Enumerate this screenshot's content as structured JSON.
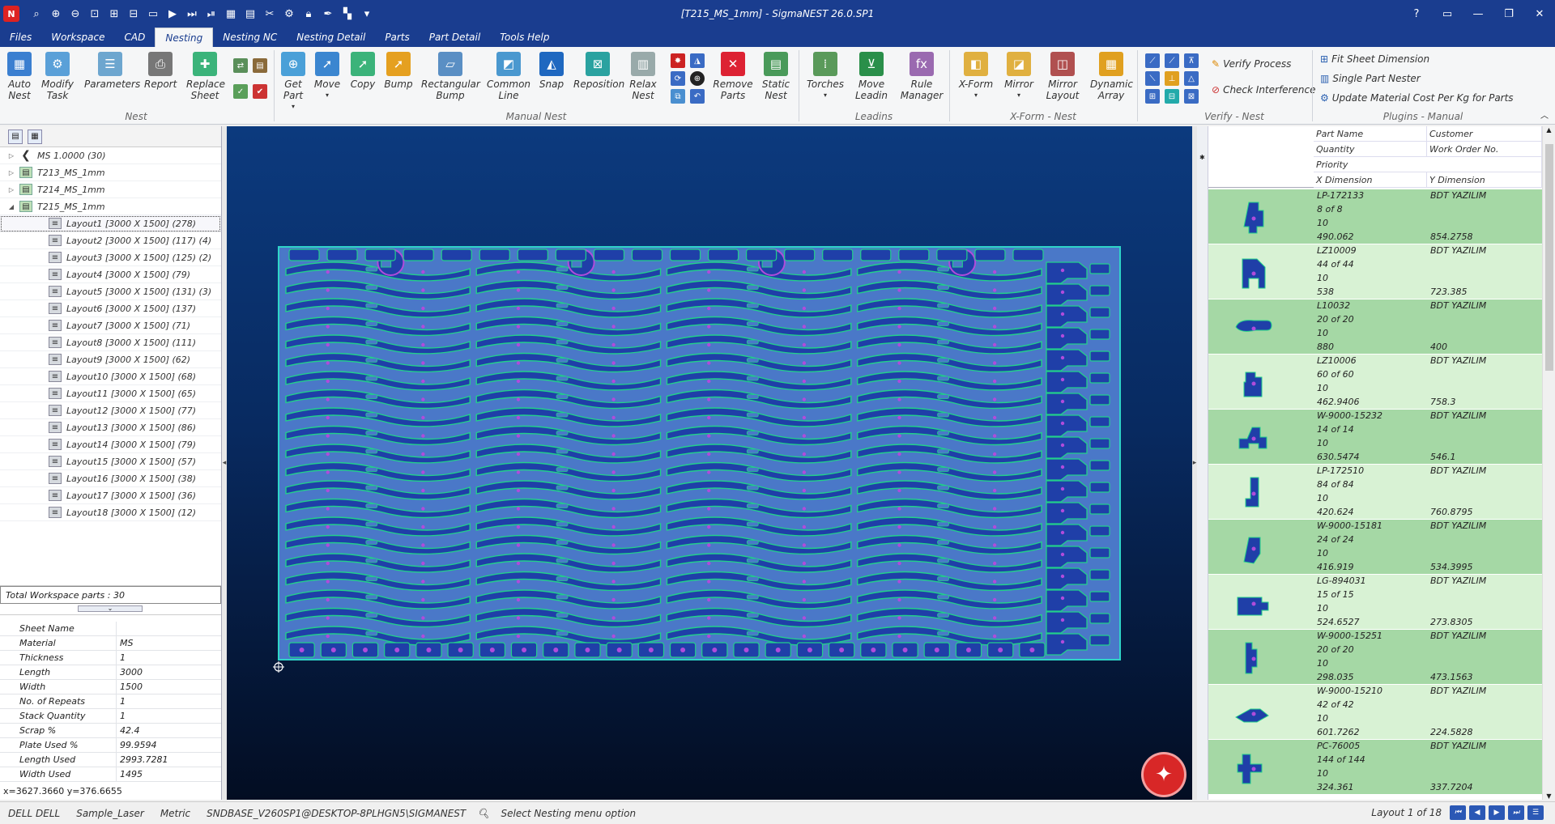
{
  "window": {
    "title": "[T215_MS_1mm] - SigmaNEST 26.0.SP1",
    "help": "?",
    "controls": [
      "minimize",
      "restore",
      "close"
    ]
  },
  "quick_access": {
    "icons": [
      "app-logo-icon",
      "zoom-menu-icon",
      "zoom-in-icon",
      "zoom-out-icon",
      "zoom-window-icon",
      "zoom-extents-icon",
      "zoom-previous-icon",
      "measure-icon",
      "play-icon",
      "play-all-icon",
      "step-icon",
      "tile-icon",
      "grid-icon",
      "undo-icon",
      "redo-icon",
      "lock-icon",
      "tool-icon",
      "bookmark-icon",
      "more-icon"
    ]
  },
  "menu_tabs": [
    "Files",
    "Workspace",
    "CAD",
    "Nesting",
    "Nesting NC",
    "Nesting Detail",
    "Parts",
    "Part Detail",
    "Tools Help"
  ],
  "active_tab": "Nesting",
  "ribbon": {
    "auto_nest": "Auto Nest",
    "modify_task": "Modify Task",
    "parameters": "Parameters",
    "report": "Report",
    "replace_sheet": "Replace Sheet",
    "get_part": "Get Part",
    "move": "Move",
    "copy": "Copy",
    "bump": "Bump",
    "rectangular_bump": "Rectangular Bump",
    "common_line": "Common Line",
    "snap": "Snap",
    "reposition": "Reposition",
    "relax_nest": "Relax Nest",
    "remove_parts": "Remove Parts",
    "static_nest": "Static Nest",
    "torches": "Torches",
    "move_leadin": "Move Leadin",
    "rule_manager": "Rule Manager",
    "x_form": "X-Form",
    "mirror": "Mirror",
    "mirror_layout": "Mirror Layout",
    "dynamic_array": "Dynamic Array",
    "verify_process": "Verify Process",
    "check_interference": "Check Interference",
    "fit_sheet_dimension": "Fit Sheet Dimension",
    "single_part_nester": "Single Part Nester",
    "update_material_cost": "Update Material Cost Per Kg for Parts",
    "groups": {
      "nest": "Nest",
      "manual_nest": "Manual Nest",
      "leadins": "Leadins",
      "xform_nest": "X-Form - Nest",
      "verify_nest": "Verify - Nest",
      "plugins_manual": "Plugins - Manual"
    }
  },
  "tree": [
    {
      "label": "MS 1.0000 (30)",
      "level": 0,
      "icon": "material-icon"
    },
    {
      "label": "T213_MS_1mm",
      "level": 0,
      "icon": "task-icon"
    },
    {
      "label": "T214_MS_1mm",
      "level": 0,
      "icon": "task-icon"
    },
    {
      "label": "T215_MS_1mm",
      "level": 0,
      "icon": "task-icon",
      "expanded": true
    },
    {
      "label": "Layout1 [3000 X 1500]  (278)",
      "level": 1,
      "selected": true
    },
    {
      "label": "Layout2 [3000 X 1500]  (117) (4)",
      "level": 1
    },
    {
      "label": "Layout3 [3000 X 1500]  (125) (2)",
      "level": 1
    },
    {
      "label": "Layout4 [3000 X 1500]  (79)",
      "level": 1
    },
    {
      "label": "Layout5 [3000 X 1500]  (131) (3)",
      "level": 1
    },
    {
      "label": "Layout6 [3000 X 1500]  (137)",
      "level": 1
    },
    {
      "label": "Layout7 [3000 X 1500]  (71)",
      "level": 1
    },
    {
      "label": "Layout8 [3000 X 1500]  (111)",
      "level": 1
    },
    {
      "label": "Layout9 [3000 X 1500]  (62)",
      "level": 1
    },
    {
      "label": "Layout10 [3000 X 1500]  (68)",
      "level": 1
    },
    {
      "label": "Layout11 [3000 X 1500]  (65)",
      "level": 1
    },
    {
      "label": "Layout12 [3000 X 1500]  (77)",
      "level": 1
    },
    {
      "label": "Layout13 [3000 X 1500]  (86)",
      "level": 1
    },
    {
      "label": "Layout14 [3000 X 1500]  (79)",
      "level": 1
    },
    {
      "label": "Layout15 [3000 X 1500]  (57)",
      "level": 1
    },
    {
      "label": "Layout16 [3000 X 1500]  (38)",
      "level": 1
    },
    {
      "label": "Layout17 [3000 X 1500]  (36)",
      "level": 1
    },
    {
      "label": "Layout18 [3000 X 1500]  (12)",
      "level": 1
    }
  ],
  "total_workspace": "Total Workspace parts : 30",
  "properties": [
    {
      "label": "Sheet Name",
      "value": ""
    },
    {
      "label": "Material",
      "value": "MS"
    },
    {
      "label": "Thickness",
      "value": "1"
    },
    {
      "label": "Length",
      "value": "3000"
    },
    {
      "label": "Width",
      "value": "1500"
    },
    {
      "label": "No. of Repeats",
      "value": "1"
    },
    {
      "label": "Stack Quantity",
      "value": "1"
    },
    {
      "label": "Scrap %",
      "value": "42.4"
    },
    {
      "label": "Plate Used %",
      "value": "99.9594"
    },
    {
      "label": "Length Used",
      "value": "2993.7281"
    },
    {
      "label": "Width Used",
      "value": "1495"
    }
  ],
  "coords": "x=3627.3660 y=376.6655",
  "parts_header": {
    "part_name": "Part Name",
    "customer": "Customer",
    "quantity": "Quantity",
    "work_order": "Work Order No.",
    "priority": "Priority",
    "x_dim": "X Dimension",
    "y_dim": "Y Dimension"
  },
  "parts": [
    {
      "name": "LP-172133",
      "customer": "BDT YAZILIM",
      "qty": "8 of 8",
      "priority": "10",
      "x": "490.062",
      "y": "854.2758",
      "shade": "dark"
    },
    {
      "name": "LZ10009",
      "customer": "BDT YAZILIM",
      "qty": "44 of 44",
      "priority": "10",
      "x": "538",
      "y": "723.385",
      "shade": "light"
    },
    {
      "name": "L10032",
      "customer": "BDT YAZILIM",
      "qty": "20 of 20",
      "priority": "10",
      "x": "880",
      "y": "400",
      "shade": "dark"
    },
    {
      "name": "LZ10006",
      "customer": "BDT YAZILIM",
      "qty": "60 of 60",
      "priority": "10",
      "x": "462.9406",
      "y": "758.3",
      "shade": "light"
    },
    {
      "name": "W-9000-15232",
      "customer": "BDT YAZILIM",
      "qty": "14 of 14",
      "priority": "10",
      "x": "630.5474",
      "y": "546.1",
      "shade": "dark"
    },
    {
      "name": "LP-172510",
      "customer": "BDT YAZILIM",
      "qty": "84 of 84",
      "priority": "10",
      "x": "420.624",
      "y": "760.8795",
      "shade": "light"
    },
    {
      "name": "W-9000-15181",
      "customer": "BDT YAZILIM",
      "qty": "24 of 24",
      "priority": "10",
      "x": "416.919",
      "y": "534.3995",
      "shade": "dark"
    },
    {
      "name": "LG-894031",
      "customer": "BDT YAZILIM",
      "qty": "15 of 15",
      "priority": "10",
      "x": "524.6527",
      "y": "273.8305",
      "shade": "light"
    },
    {
      "name": "W-9000-15251",
      "customer": "BDT YAZILIM",
      "qty": "20 of 20",
      "priority": "10",
      "x": "298.035",
      "y": "473.1563",
      "shade": "dark"
    },
    {
      "name": "W-9000-15210",
      "customer": "BDT YAZILIM",
      "qty": "42 of 42",
      "priority": "10",
      "x": "601.7262",
      "y": "224.5828",
      "shade": "light"
    },
    {
      "name": "PC-76005",
      "customer": "BDT YAZILIM",
      "qty": "144 of 144",
      "priority": "10",
      "x": "324.361",
      "y": "337.7204",
      "shade": "dark"
    }
  ],
  "status": {
    "machine": "DELL DELL",
    "post": "Sample_Laser",
    "units": "Metric",
    "database": "SNDBASE_V260SP1@DESKTOP-8PLHGN5\\SIGMANEST",
    "message": "Select Nesting menu option",
    "layout": "Layout 1 of 18"
  },
  "colors": {
    "titlebar": "#1a3d8f",
    "sheet_fill": "#4a78c8",
    "part_fill": "#1f3fa8",
    "part_outline": "#22d08a",
    "hole": "#b04cdb",
    "row_dark": "#a5d8a5",
    "row_light": "#d8f2d4"
  }
}
